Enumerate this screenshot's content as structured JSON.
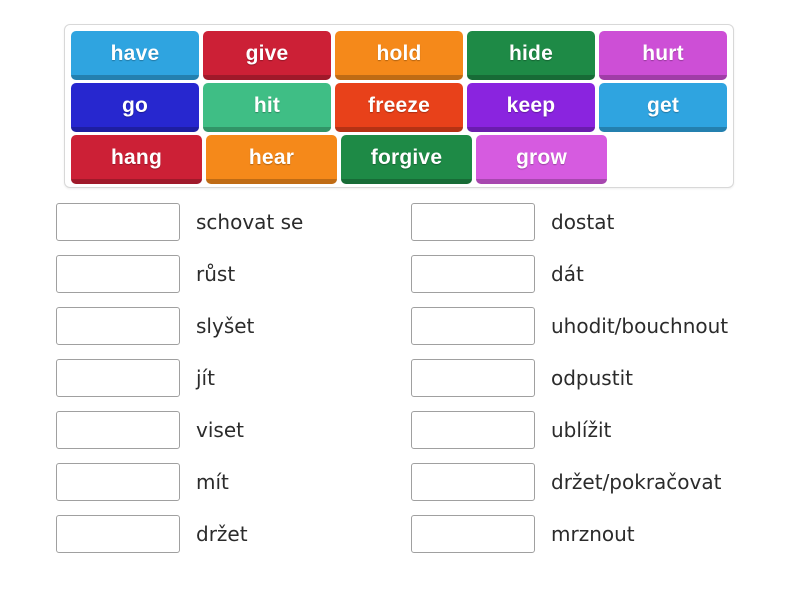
{
  "word_bank": {
    "rows": [
      [
        {
          "label": "have",
          "color": "#2fa4e0"
        },
        {
          "label": "give",
          "color": "#cc2036"
        },
        {
          "label": "hold",
          "color": "#f5891a"
        },
        {
          "label": "hide",
          "color": "#1e8a46"
        },
        {
          "label": "hurt",
          "color": "#cd4fd6"
        }
      ],
      [
        {
          "label": "go",
          "color": "#2727cf"
        },
        {
          "label": "hit",
          "color": "#3fbe85"
        },
        {
          "label": "freeze",
          "color": "#e8411a"
        },
        {
          "label": "keep",
          "color": "#8a24df"
        },
        {
          "label": "get",
          "color": "#2fa4e0"
        }
      ],
      [
        {
          "label": "hang",
          "color": "#cc2036"
        },
        {
          "label": "hear",
          "color": "#f5891a"
        },
        {
          "label": "forgive",
          "color": "#1e8a46"
        },
        {
          "label": "grow",
          "color": "#d65be0"
        }
      ]
    ]
  },
  "answers": {
    "left_column": [
      {
        "box_value": "",
        "label": "schovat se"
      },
      {
        "box_value": "",
        "label": "růst"
      },
      {
        "box_value": "",
        "label": "slyšet"
      },
      {
        "box_value": "",
        "label": "jít"
      },
      {
        "box_value": "",
        "label": "viset"
      },
      {
        "box_value": "",
        "label": "mít"
      },
      {
        "box_value": "",
        "label": "držet"
      }
    ],
    "right_column": [
      {
        "box_value": "",
        "label": "dostat"
      },
      {
        "box_value": "",
        "label": "dát"
      },
      {
        "box_value": "",
        "label": "uhodit/bouchnout"
      },
      {
        "box_value": "",
        "label": "odpustit"
      },
      {
        "box_value": "",
        "label": "ublížit"
      },
      {
        "box_value": "",
        "label": "držet/pokračovat"
      },
      {
        "box_value": "",
        "label": "mrznout"
      }
    ]
  }
}
